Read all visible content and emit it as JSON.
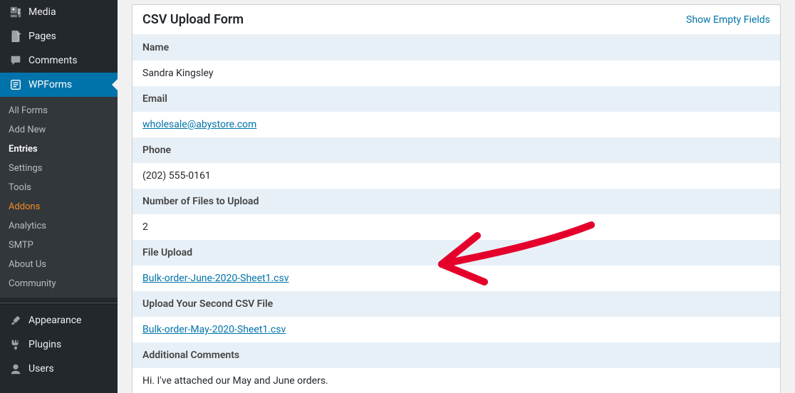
{
  "sidebar": {
    "items": [
      {
        "label": "Media",
        "icon": "media"
      },
      {
        "label": "Pages",
        "icon": "page"
      },
      {
        "label": "Comments",
        "icon": "comment"
      },
      {
        "label": "WPForms",
        "icon": "form",
        "active": true
      },
      {
        "label": "Appearance",
        "icon": "brush"
      },
      {
        "label": "Plugins",
        "icon": "plug"
      },
      {
        "label": "Users",
        "icon": "user"
      }
    ],
    "submenu": [
      {
        "label": "All Forms"
      },
      {
        "label": "Add New"
      },
      {
        "label": "Entries",
        "current": true
      },
      {
        "label": "Settings"
      },
      {
        "label": "Tools"
      },
      {
        "label": "Addons",
        "highlight": true
      },
      {
        "label": "Analytics"
      },
      {
        "label": "SMTP"
      },
      {
        "label": "About Us"
      },
      {
        "label": "Community"
      }
    ]
  },
  "panel": {
    "title": "CSV Upload Form",
    "show_empty": "Show Empty Fields",
    "rows": [
      {
        "type": "label",
        "text": "Name"
      },
      {
        "type": "value",
        "text": "Sandra Kingsley"
      },
      {
        "type": "label",
        "text": "Email"
      },
      {
        "type": "link",
        "text": "wholesale@abystore.com"
      },
      {
        "type": "label",
        "text": "Phone"
      },
      {
        "type": "value",
        "text": "(202) 555-0161"
      },
      {
        "type": "label",
        "text": "Number of Files to Upload"
      },
      {
        "type": "value",
        "text": "2"
      },
      {
        "type": "label",
        "text": "File Upload"
      },
      {
        "type": "link",
        "text": "Bulk-order-June-2020-Sheet1.csv"
      },
      {
        "type": "label",
        "text": "Upload Your Second CSV File"
      },
      {
        "type": "link",
        "text": "Bulk-order-May-2020-Sheet1.csv"
      },
      {
        "type": "label",
        "text": "Additional Comments"
      },
      {
        "type": "value",
        "text": "Hi. I've attached our May and June orders."
      }
    ]
  }
}
